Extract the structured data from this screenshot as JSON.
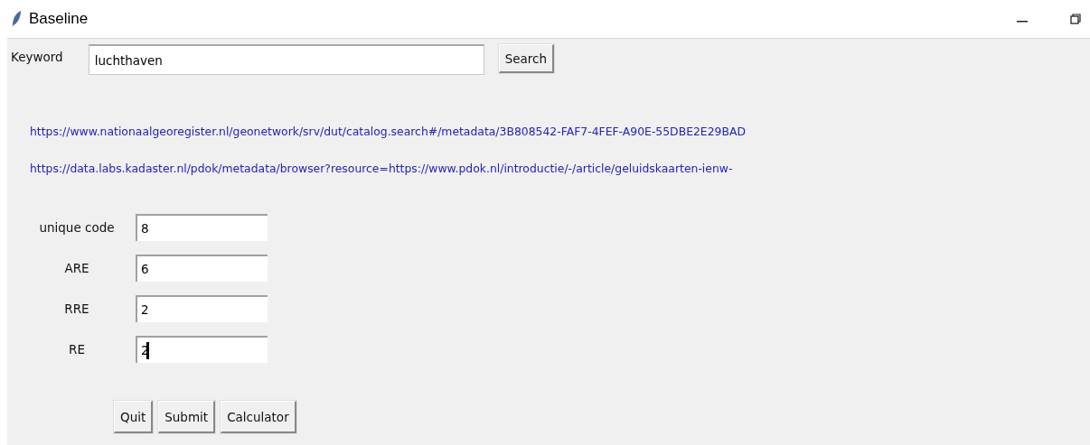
{
  "window": {
    "title": "Baseline"
  },
  "keyword": {
    "label": "Keyword",
    "value": "luchthaven",
    "button": "Search"
  },
  "links": [
    "https://www.nationaalgeoregister.nl/geonetwork/srv/dut/catalog.search#/metadata/3B808542-FAF7-4FEF-A90E-55DBE2E29BAD",
    "https://data.labs.kadaster.nl/pdok/metadata/browser?resource=https://www.pdok.nl/introductie/-/article/geluidskaarten-ienw-"
  ],
  "fields": [
    {
      "label": "unique code",
      "value": "8",
      "focused": false
    },
    {
      "label": "ARE",
      "value": "6",
      "focused": false
    },
    {
      "label": "RRE",
      "value": "2",
      "focused": false
    },
    {
      "label": "RE",
      "value": "2",
      "focused": true
    }
  ],
  "buttons": [
    "Quit",
    "Submit",
    "Calculator"
  ]
}
